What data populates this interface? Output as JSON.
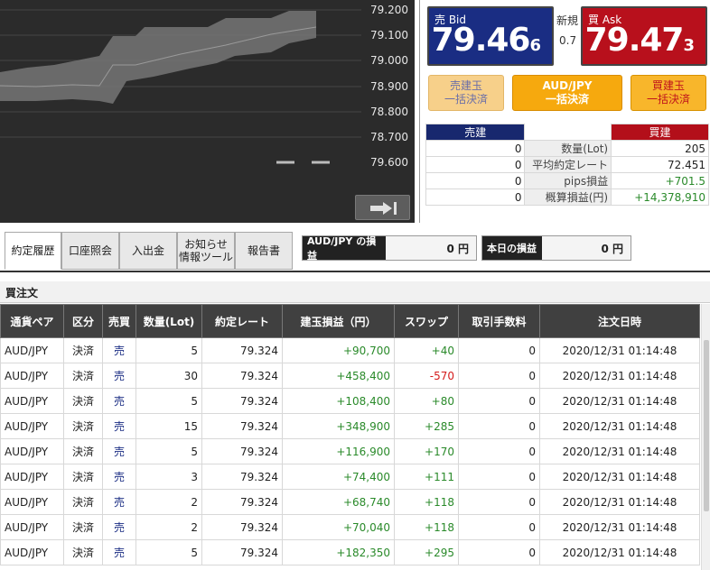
{
  "chart": {
    "ticks": [
      "79.200",
      "79.100",
      "79.000",
      "78.900",
      "78.800",
      "78.700",
      "79.600"
    ]
  },
  "quote": {
    "bid_label": "売 Bid",
    "bid_main": "79.46",
    "bid_pip": "6",
    "ask_label": "買 Ask",
    "ask_main": "79.47",
    "ask_pip": "3",
    "new_label": "新規",
    "spread": "0.7"
  },
  "settle": {
    "sell_line1": "売建玉",
    "sell_line2": "一括決済",
    "all_line1": "AUD/JPY",
    "all_line2": "一括決済",
    "buy_line1": "買建玉",
    "buy_line2": "一括決済"
  },
  "positions": {
    "sell_header": "売建",
    "buy_header": "買建",
    "rows": [
      {
        "sell": "0",
        "label": "数量(Lot)",
        "buy": "205"
      },
      {
        "sell": "0",
        "label": "平均約定レート",
        "buy": "72.451"
      },
      {
        "sell": "0",
        "label": "pips損益",
        "buy": "+701.5"
      },
      {
        "sell": "0",
        "label": "概算損益(円)",
        "buy": "+14,378,910"
      }
    ]
  },
  "tabs": [
    {
      "label": "約定履歴"
    },
    {
      "label": "口座照会"
    },
    {
      "label": "入出金"
    },
    {
      "label": "お知らせ\n情報ツール"
    },
    {
      "label": "報告書"
    }
  ],
  "pnl": {
    "pair_title": "AUD/JPY の損益",
    "pair_value": "0 円",
    "today_title": "本日の損益",
    "today_value": "0 円"
  },
  "orders": {
    "section_title": "買注文",
    "columns": [
      "通貨ペア",
      "区分",
      "売買",
      "数量(Lot)",
      "約定レート",
      "建玉損益（円）",
      "スワップ",
      "取引手数料",
      "注文日時"
    ],
    "rows": [
      [
        "AUD/JPY",
        "決済",
        "売",
        "5",
        "79.324",
        "+90,700",
        "+40",
        "0",
        "2020/12/31 01:14:48"
      ],
      [
        "AUD/JPY",
        "決済",
        "売",
        "30",
        "79.324",
        "+458,400",
        "-570",
        "0",
        "2020/12/31 01:14:48"
      ],
      [
        "AUD/JPY",
        "決済",
        "売",
        "5",
        "79.324",
        "+108,400",
        "+80",
        "0",
        "2020/12/31 01:14:48"
      ],
      [
        "AUD/JPY",
        "決済",
        "売",
        "15",
        "79.324",
        "+348,900",
        "+285",
        "0",
        "2020/12/31 01:14:48"
      ],
      [
        "AUD/JPY",
        "決済",
        "売",
        "5",
        "79.324",
        "+116,900",
        "+170",
        "0",
        "2020/12/31 01:14:48"
      ],
      [
        "AUD/JPY",
        "決済",
        "売",
        "3",
        "79.324",
        "+74,400",
        "+111",
        "0",
        "2020/12/31 01:14:48"
      ],
      [
        "AUD/JPY",
        "決済",
        "売",
        "2",
        "79.324",
        "+68,740",
        "+118",
        "0",
        "2020/12/31 01:14:48"
      ],
      [
        "AUD/JPY",
        "決済",
        "売",
        "2",
        "79.324",
        "+70,040",
        "+118",
        "0",
        "2020/12/31 01:14:48"
      ],
      [
        "AUD/JPY",
        "決済",
        "売",
        "5",
        "79.324",
        "+182,350",
        "+295",
        "0",
        "2020/12/31 01:14:48"
      ]
    ]
  },
  "colors": {
    "bid_bg": "#1a2d83",
    "ask_bg": "#b8101c",
    "positive": "#2a8a2a",
    "negative": "#d41c1c"
  }
}
